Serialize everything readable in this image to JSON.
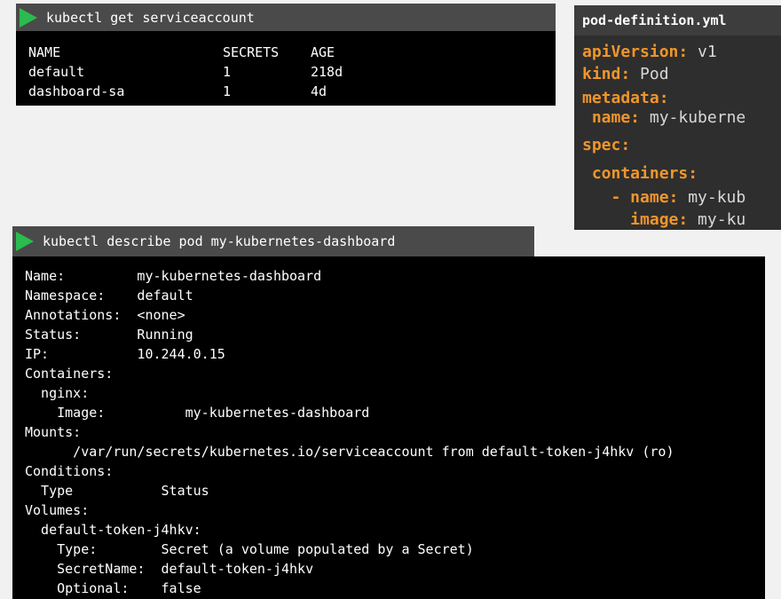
{
  "top_command": {
    "text": "kubectl get serviceaccount"
  },
  "sa_table": {
    "headers": [
      "NAME",
      "SECRETS",
      "AGE"
    ],
    "rows": [
      [
        "default",
        "1",
        "218d"
      ],
      [
        "dashboard-sa",
        "1",
        "4d"
      ]
    ]
  },
  "yaml_panel": {
    "title": "pod-definition.yml",
    "lines": [
      {
        "key": "apiVersion:",
        "val": " v1"
      },
      {
        "key": "kind:",
        "val": " Pod"
      },
      {
        "key": "metadata:",
        "val": ""
      },
      {
        "key": " name:",
        "val": " my-kuberne"
      },
      {
        "key": "spec:",
        "val": ""
      },
      {
        "key": " containers:",
        "val": ""
      },
      {
        "key": "   - name:",
        "val": " my-kub"
      },
      {
        "key": "     image:",
        "val": " my-ku"
      }
    ]
  },
  "describe_command": {
    "text": "kubectl describe pod my-kubernetes-dashboard"
  },
  "describe_output": {
    "lines": [
      "Name:         my-kubernetes-dashboard",
      "Namespace:    default",
      "Annotations:  <none>",
      "Status:       Running",
      "IP:           10.244.0.15",
      "Containers:",
      "  nginx:",
      "    Image:          my-kubernetes-dashboard",
      "Mounts:",
      "      /var/run/secrets/kubernetes.io/serviceaccount from default-token-j4hkv (ro)",
      "Conditions:",
      "  Type           Status",
      "Volumes:",
      "  default-token-j4hkv:",
      "    Type:        Secret (a volume populated by a Secret)",
      "    SecretName:  default-token-j4hkv",
      "    Optional:    false"
    ]
  },
  "colors": {
    "play_icon": "#2bbb4e",
    "yaml_key": "#f0952b",
    "terminal_bg": "#000000",
    "command_bar_bg": "#4a4a4a"
  }
}
